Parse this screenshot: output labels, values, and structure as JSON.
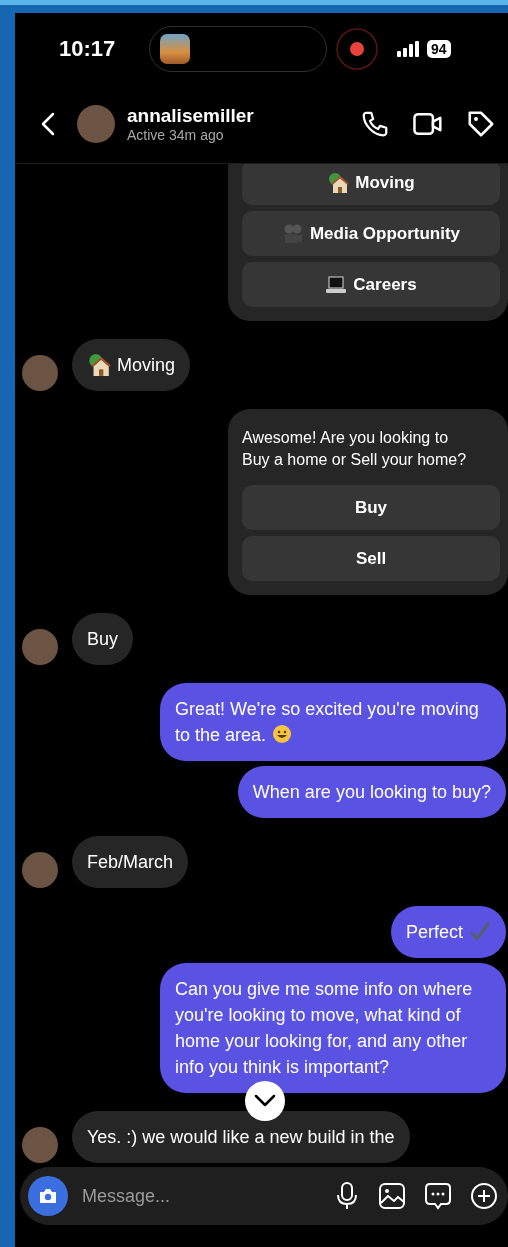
{
  "status_bar": {
    "time": "10:17",
    "battery": "94"
  },
  "header": {
    "username": "annalisemiller",
    "status": "Active 34m ago"
  },
  "messages": [
    {
      "kind": "card",
      "options": [
        {
          "label": "Moving"
        },
        {
          "label": "Media Opportunity"
        },
        {
          "label": "Careers"
        }
      ]
    },
    {
      "kind": "received",
      "text": "Moving"
    },
    {
      "kind": "card",
      "text": "Awesome! Are you looking to Buy a home or Sell your home?",
      "options": [
        {
          "label": "Buy"
        },
        {
          "label": "Sell"
        }
      ]
    },
    {
      "kind": "received",
      "text": "Buy"
    },
    {
      "kind": "sent",
      "text": "Great! We're so excited you're moving to the area."
    },
    {
      "kind": "sent",
      "text": "When are you looking to buy?"
    },
    {
      "kind": "received",
      "text": "Feb/March"
    },
    {
      "kind": "sent",
      "text": "Perfect"
    },
    {
      "kind": "sent",
      "text": "Can you give me some info on where you're looking to move, what kind of home your looking for, and any other info you think is important?"
    },
    {
      "kind": "received",
      "text": "Yes. :) we would like a new build in the"
    }
  ],
  "composer": {
    "placeholder": "Message..."
  }
}
